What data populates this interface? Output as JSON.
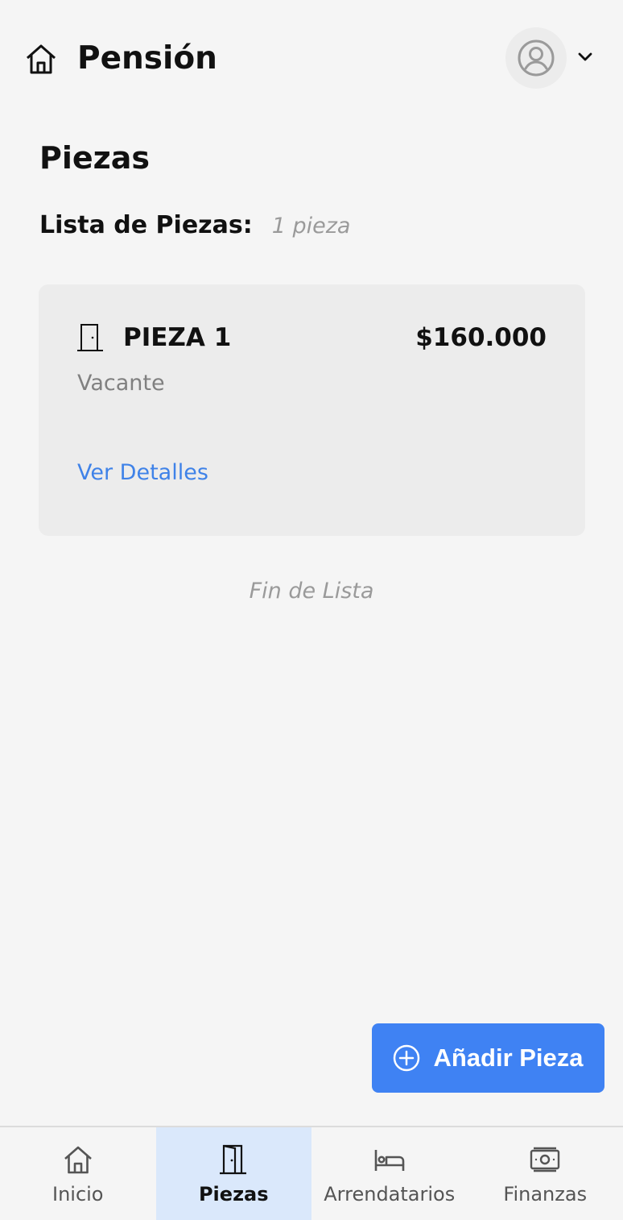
{
  "app": {
    "title": "Pensión"
  },
  "page": {
    "title": "Piezas",
    "list_label": "Lista de Piezas:",
    "list_count": "1 pieza",
    "end_of_list": "Fin de Lista"
  },
  "rooms": [
    {
      "name": "PIEZA 1",
      "price": "$160.000",
      "status": "Vacante",
      "details_link": "Ver Detalles",
      "icon": "door-icon"
    }
  ],
  "fab": {
    "label": "Añadir Pieza",
    "icon": "plus-circle-icon"
  },
  "bottom_nav": {
    "items": [
      {
        "label": "Inicio",
        "icon": "home-icon",
        "active": false
      },
      {
        "label": "Piezas",
        "icon": "door-icon",
        "active": true
      },
      {
        "label": "Arrendatarios",
        "icon": "bed-icon",
        "active": false
      },
      {
        "label": "Finanzas",
        "icon": "money-icon",
        "active": false
      }
    ]
  },
  "colors": {
    "background": "#f5f5f5",
    "card": "#ececec",
    "accent": "#3f82f3",
    "link": "#3f82e8",
    "nav_active": "#dae8fb",
    "muted_text": "#9a9a9a"
  }
}
